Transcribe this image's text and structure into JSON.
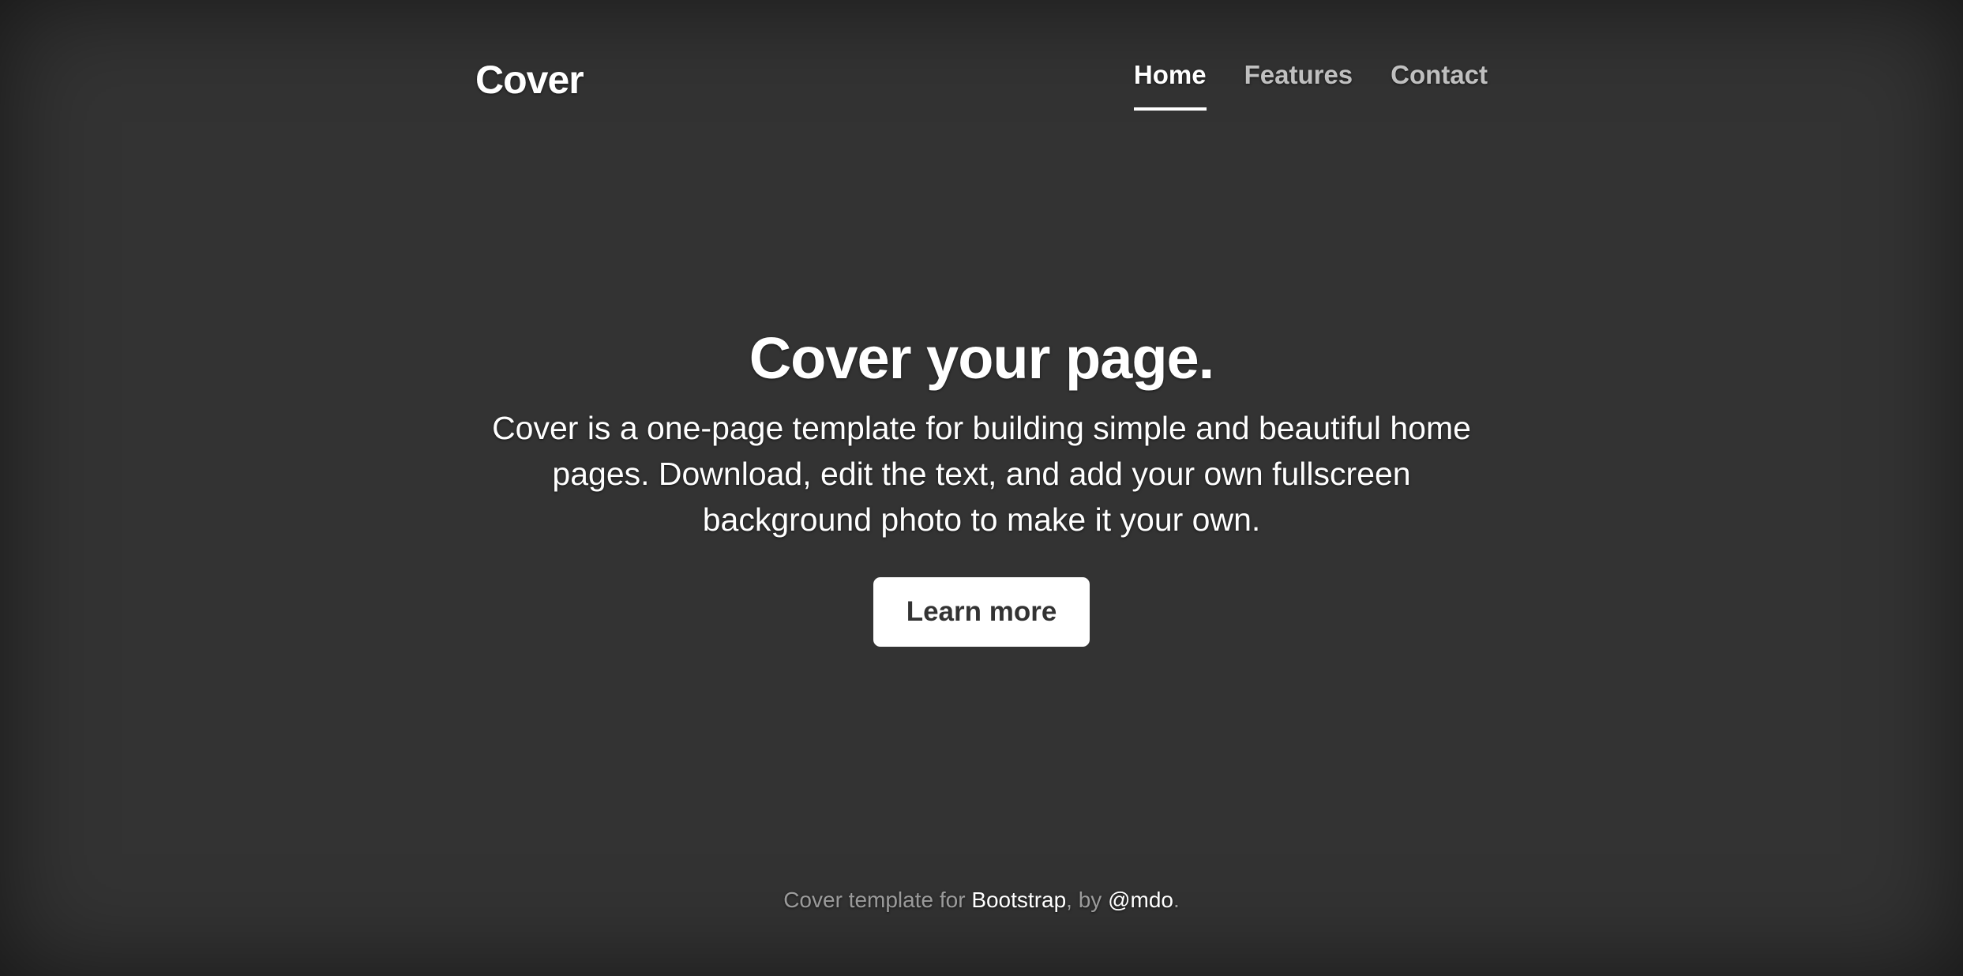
{
  "brand": "Cover",
  "nav": {
    "items": [
      {
        "label": "Home",
        "active": true
      },
      {
        "label": "Features",
        "active": false
      },
      {
        "label": "Contact",
        "active": false
      }
    ]
  },
  "hero": {
    "title": "Cover your page.",
    "lead": "Cover is a one-page template for building simple and beautiful home pages. Download, edit the text, and add your own fullscreen background photo to make it your own.",
    "button_label": "Learn more"
  },
  "footer": {
    "prefix": "Cover template for ",
    "link1": "Bootstrap",
    "middle": ", by ",
    "link2": "@mdo",
    "suffix": "."
  },
  "colors": {
    "background": "#333333",
    "text": "#ffffff",
    "button_text": "#333333"
  }
}
